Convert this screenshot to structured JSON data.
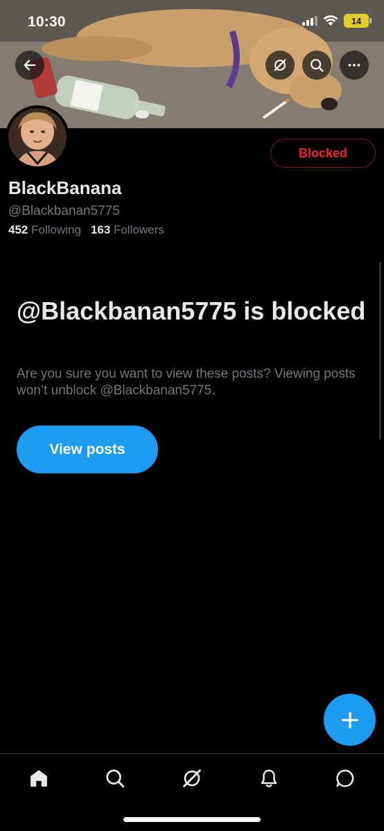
{
  "status_bar": {
    "time": "10:30",
    "battery": "14",
    "battery_color": "#e4cf2a"
  },
  "banner": {
    "description_icons": [
      "back-arrow-icon",
      "grok-icon",
      "search-icon",
      "more-icon"
    ]
  },
  "profile": {
    "display_name": "BlackBanana",
    "handle": "@Blackbanan5775",
    "following_count": "452",
    "following_label": "Following",
    "followers_count": "163",
    "followers_label": "Followers",
    "blocked_button_label": "Blocked"
  },
  "blocked_notice": {
    "title": "@Blackbanan5775 is blocked",
    "description": "Are you sure you want to view these posts? Viewing posts won’t unblock @Blackbanan5775.",
    "view_posts_label": "View posts"
  },
  "tab_bar": {
    "items": [
      "home-icon",
      "search-icon",
      "grok-icon",
      "notifications-icon",
      "messages-icon"
    ]
  },
  "colors": {
    "accent": "#1d9bf0",
    "blocked_red": "#f4212e",
    "muted_text": "#71767b",
    "primary_text": "#e7e9ea"
  }
}
